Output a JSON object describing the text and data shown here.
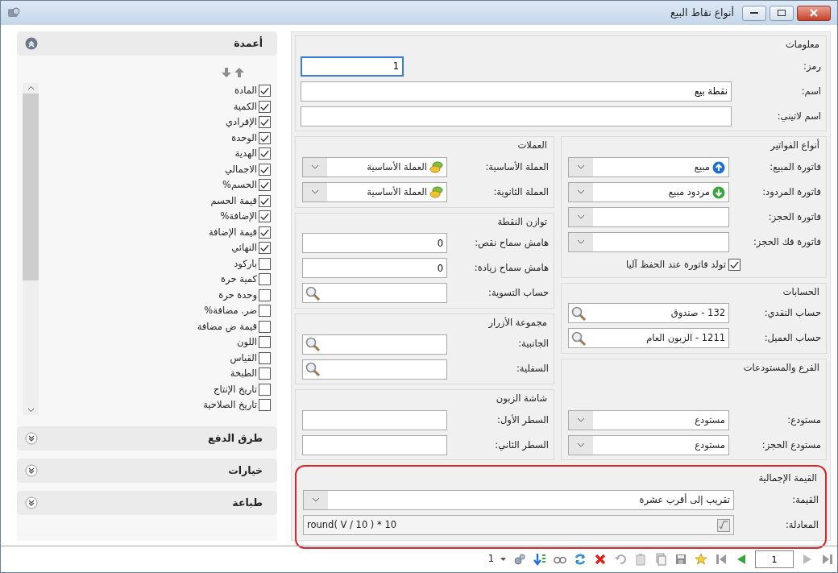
{
  "window": {
    "title": "أنواع نقاط البيع"
  },
  "sidebar": {
    "panels": [
      {
        "title": "أعمدة",
        "expanded": true,
        "items": [
          {
            "label": "المادة",
            "checked": true
          },
          {
            "label": "الكمية",
            "checked": true
          },
          {
            "label": "الإفرادي",
            "checked": true
          },
          {
            "label": "الوحدة",
            "checked": true
          },
          {
            "label": "الهدية",
            "checked": true
          },
          {
            "label": "الاجمالي",
            "checked": true
          },
          {
            "label": "الحسم%",
            "checked": true
          },
          {
            "label": "قيمة الحسم",
            "checked": true
          },
          {
            "label": "الإضافة%",
            "checked": true
          },
          {
            "label": "قيمة الإضافة",
            "checked": true
          },
          {
            "label": "النهائي",
            "checked": true
          },
          {
            "label": "باركود",
            "checked": false
          },
          {
            "label": "كمية حرة",
            "checked": false
          },
          {
            "label": "وحدة حرة",
            "checked": false
          },
          {
            "label": "ضر. مضافة%",
            "checked": false
          },
          {
            "label": "قيمة ض مضافة",
            "checked": false
          },
          {
            "label": "اللون",
            "checked": false
          },
          {
            "label": "القياس",
            "checked": false
          },
          {
            "label": "الطبخة",
            "checked": false
          },
          {
            "label": "تاريخ الإنتاج",
            "checked": false
          },
          {
            "label": "تاريخ الصلاحية",
            "checked": false
          }
        ]
      },
      {
        "title": "طرق الدفع",
        "expanded": false
      },
      {
        "title": "خيارات",
        "expanded": false
      },
      {
        "title": "طباعة",
        "expanded": false
      }
    ]
  },
  "info": {
    "title": "معلومات",
    "fields": [
      {
        "label": "رمز:",
        "kind": "text",
        "value": "1",
        "focused": true
      },
      {
        "label": "اسم:",
        "kind": "text",
        "value": "نقطة بيع"
      },
      {
        "label": "اسم لاتيني:",
        "kind": "text"
      }
    ]
  },
  "invoice_types": {
    "title": "أنواع الفواتير",
    "fields": [
      {
        "label": "فاتورة المبيع:",
        "kind": "combo",
        "value": "مبيع",
        "icon": {
          "kind": "sale"
        }
      },
      {
        "label": "فاتورة المردود:",
        "kind": "combo",
        "value": "مردود مبيع",
        "icon": {
          "kind": "return"
        }
      },
      {
        "label": "فاتورة الحجز:",
        "kind": "combo"
      },
      {
        "label": "فاتورة فك الحجز:",
        "kind": "combo"
      }
    ],
    "auto_generate": {
      "label": "تولد فاتورة عند الحفظ آليا",
      "checked": true
    }
  },
  "accounts": {
    "title": "الحسابات",
    "fields": [
      {
        "label": "حساب النقدي:",
        "kind": "lookup",
        "value": "132 - صندوق"
      },
      {
        "label": "حساب العميل:",
        "kind": "lookup",
        "value": "1211 - الزبون العام"
      }
    ]
  },
  "branch": {
    "title": "الفرع والمستودعات",
    "fields": [
      {
        "label": "مستودع:",
        "kind": "combo",
        "value": "مستودع"
      },
      {
        "label": "مستودع الحجز:",
        "kind": "combo",
        "value": "مستودع"
      }
    ]
  },
  "currencies": {
    "title": "العملات",
    "fields": [
      {
        "label": "العملة الأساسية:",
        "kind": "combo",
        "value": "العملة الأساسية",
        "icon": {
          "kind": "currency"
        }
      },
      {
        "label": "العملة الثانوية:",
        "kind": "combo",
        "value": "العملة الأساسية",
        "icon": {
          "kind": "currency"
        }
      }
    ]
  },
  "balance": {
    "title": "توازن النقطة",
    "fields": [
      {
        "label": "هامش سماح نقص:",
        "kind": "text",
        "value": "0"
      },
      {
        "label": "هامش سماح زيادة:",
        "kind": "text",
        "value": "0"
      },
      {
        "label": "حساب التسوية:",
        "kind": "lookup"
      }
    ]
  },
  "button_groups": {
    "title": "مجموعة الأزرار",
    "fields": [
      {
        "label": "الجانبية:",
        "kind": "lookup"
      },
      {
        "label": "السفلية:",
        "kind": "lookup"
      }
    ]
  },
  "customer_screen": {
    "title": "شاشة الزبون",
    "fields": [
      {
        "label": "السطر الأول:",
        "kind": "text"
      },
      {
        "label": "السطر الثاني:",
        "kind": "text"
      }
    ]
  },
  "total": {
    "title": "القيمة الإجمالية",
    "highlighted": true,
    "fields": [
      {
        "label": "القيمة:",
        "kind": "combo",
        "value": "تقريب إلى أقرب عشرة"
      },
      {
        "label": "المعادلة:",
        "kind": "formula",
        "value": "round( V / 10 ) * 10"
      }
    ]
  },
  "footer": {
    "page": "1",
    "count": "1"
  }
}
